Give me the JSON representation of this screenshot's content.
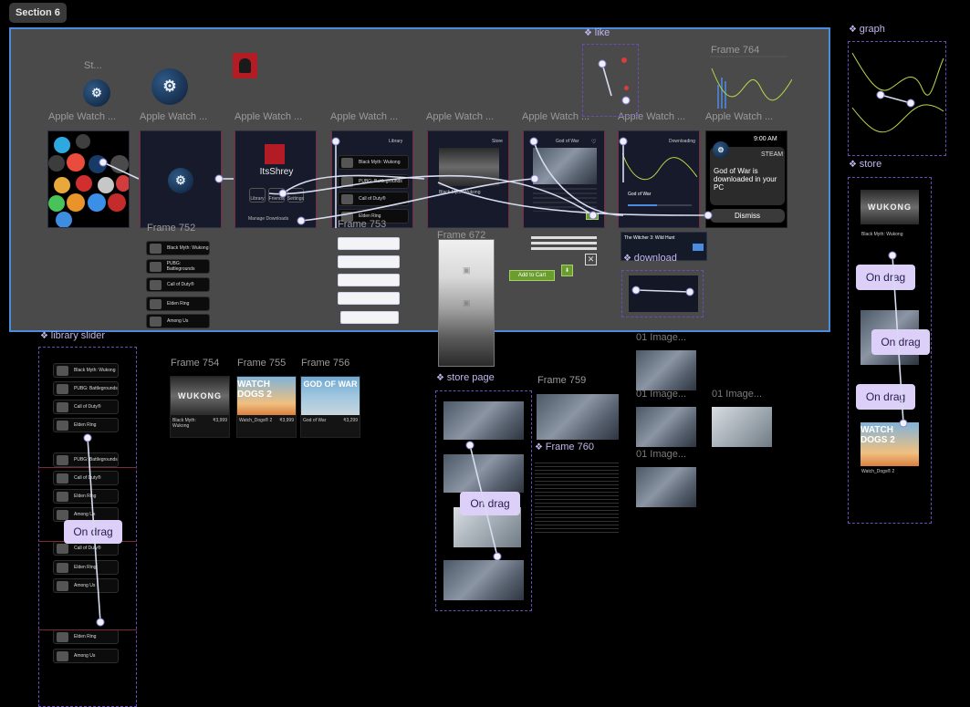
{
  "section": {
    "tag": "Section 6"
  },
  "watch_labels": [
    "Apple Watch ...",
    "Apple Watch ...",
    "Apple Watch ...",
    "Apple Watch ...",
    "Apple Watch ...",
    "Apple Watch ...",
    "Apple Watch ...",
    "Apple Watch ..."
  ],
  "st_label": "St...",
  "profile": {
    "name": "ItsShrey",
    "manage": "Manage Downloads",
    "btns": [
      "Library",
      "Friends",
      "Settings"
    ]
  },
  "library_screen": {
    "header": "Library",
    "items": [
      "Black Myth: Wukong",
      "PUBG: Battlegrounds",
      "Call of Duty®",
      "Elden Ring"
    ]
  },
  "store_screen": {
    "header": "Store",
    "game": "Black Myth: Wukong"
  },
  "gow_screen": {
    "title": "God of War"
  },
  "download_screen": {
    "header": "Downloading",
    "game": "God of War"
  },
  "notification": {
    "time": "9:00 AM",
    "app": "STEAM",
    "text": "God of War is downloaded in your PC",
    "dismiss": "Dismiss"
  },
  "frames": {
    "f764": "Frame 764",
    "f752": "Frame 752",
    "f753": "Frame 753",
    "f672": "Frame 672",
    "f754": "Frame 754",
    "f755": "Frame 755",
    "f756": "Frame 756",
    "f759": "Frame 759",
    "f760": "Frame 760",
    "img1": "01 Image...",
    "img2": "01 Image...",
    "img3": "01 Image...",
    "img4": "01 Image..."
  },
  "components": {
    "like": "like",
    "graph": "graph",
    "store": "store",
    "download": "download",
    "library_slider": "library slider",
    "store_page": "store page"
  },
  "frame752_items": [
    "Black Myth: Wukong",
    "PUBG: Battlegrounds",
    "Call of Duty®",
    "Elden Ring",
    "Among Us"
  ],
  "library_slider_items": [
    "Black Myth: Wukong",
    "PUBG: Battlegrounds",
    "Call of Duty®",
    "Elden Ring",
    "",
    "PUBG: Battlegrounds",
    "Call of Duty®",
    "Elden Ring",
    "Among Us",
    "",
    "Call of Duty®",
    "Elden Ring",
    "Among Us",
    "",
    "Elden Ring",
    "Among Us"
  ],
  "witcher": {
    "title": "The Witcher 3: Wild Hunt"
  },
  "add_to_cart": "Add to Cart",
  "on_drag": "On drag",
  "cards": [
    {
      "name": "Black Myth: Wukong",
      "price": "₹3,999",
      "art": "WUKONG",
      "cls": "wukong"
    },
    {
      "name": "Watch_Dogs® 2",
      "price": "₹3,999",
      "art": "WATCH DOGS 2",
      "cls": "wd"
    },
    {
      "name": "God of War",
      "price": "₹3,299",
      "art": "GOD OF WAR",
      "cls": "gow"
    }
  ],
  "store_panel": {
    "game1": "Black Myth: Wukong",
    "art1": "WUKONG",
    "game2": "Watch_Dogs® 2",
    "art2": "WATCH DOGS 2"
  },
  "colors": {
    "accent": "#4b8ce0",
    "component": "#c2b6ec",
    "drag": "#dccff8",
    "green": "#6a9c2e"
  }
}
